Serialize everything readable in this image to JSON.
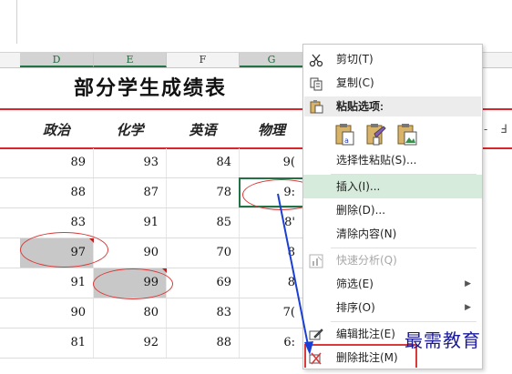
{
  "sheet": {
    "column_headers": [
      "D",
      "E",
      "F",
      "G"
    ],
    "title": "部分学生成绩表",
    "subject_headers": [
      "政治",
      "化学",
      "英语",
      "物理"
    ],
    "rows": [
      [
        "89",
        "93",
        "84",
        "9("
      ],
      [
        "88",
        "87",
        "78",
        "9:"
      ],
      [
        "83",
        "91",
        "85",
        "8'"
      ],
      [
        "97",
        "90",
        "70",
        "8"
      ],
      [
        "91",
        "99",
        "69",
        "8"
      ],
      [
        "90",
        "80",
        "83",
        "7("
      ],
      [
        "81",
        "92",
        "88",
        "6:"
      ]
    ],
    "right_marks": [
      "-",
      "Ⅎ"
    ]
  },
  "context_menu": {
    "cut": "剪切(T)",
    "copy": "复制(C)",
    "paste_options": "粘贴选项:",
    "paste_special": "选择性粘贴(S)...",
    "insert": "插入(I)...",
    "delete": "删除(D)...",
    "clear_contents": "清除内容(N)",
    "quick_analysis": "快速分析(Q)",
    "filter": "筛选(E)",
    "sort": "排序(O)",
    "edit_comment": "编辑批注(E)",
    "delete_comment": "删除批注(M)"
  },
  "watermark": "最需教育",
  "colors": {
    "accent_green": "#217346",
    "red_rule": "#d9262b",
    "highlight_row": "#d6ebdb",
    "annotation_red": "#d93a3a",
    "arrow_blue": "#1a3fd6"
  }
}
